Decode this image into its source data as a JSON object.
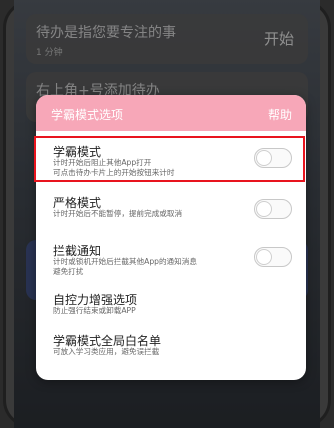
{
  "background_tasks": [
    {
      "title": "待办是指您要专注的事",
      "meta": "1 分钟",
      "action": "开始"
    },
    {
      "title": "右上角+号添加待办",
      "meta": "",
      "action": ""
    }
  ],
  "dialog": {
    "title": "学霸模式选项",
    "help_label": "帮助",
    "options": [
      {
        "title": "学霸模式",
        "desc": "计时开始后阻止其他App打开\n可点击待办卡片上的开始按钮来计时",
        "toggle": false
      },
      {
        "title": "严格模式",
        "desc": "计时开始后不能暂停，提前完成或取消",
        "toggle": false
      },
      {
        "title": "拦截通知",
        "desc": "计时或锁机开始后拦截其他App的通知消息\n避免打扰",
        "toggle": false,
        "info_icon": "?"
      },
      {
        "title": "自控力增强选项",
        "desc": "防止强行结束或卸载APP"
      },
      {
        "title": "学霸模式全局白名单",
        "desc": "可放入学习类应用，避免误拦截"
      }
    ]
  },
  "colors": {
    "header": "#f7a7b8",
    "highlight": "#e8141e"
  }
}
